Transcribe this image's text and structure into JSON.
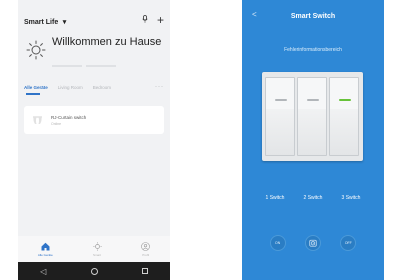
{
  "left_app": {
    "title": "Smart Life",
    "title_caret": "▾",
    "welcome": "Willkommen zu Hause",
    "tabs": [
      {
        "label": "Alle Geräte",
        "active": true
      },
      {
        "label": "Living Room",
        "active": false
      },
      {
        "label": "Bedroom",
        "active": false
      }
    ],
    "more": "···",
    "device": {
      "name": "RJ-Curtain switch",
      "status": "Online"
    },
    "nav": [
      {
        "label": "Alle Geräte",
        "icon": "home-icon",
        "active": true
      },
      {
        "label": "Smart",
        "icon": "sun-outline-icon",
        "active": false
      },
      {
        "label": "Profil",
        "icon": "profile-icon",
        "active": false
      }
    ],
    "android": {
      "back": "◁"
    }
  },
  "right_app": {
    "title": "Smart Switch",
    "back": "<",
    "fault_area": "Fehlerinformationsbereich",
    "switches": [
      {
        "label": "1 Switch",
        "on": false
      },
      {
        "label": "2 Switch",
        "on": false
      },
      {
        "label": "3 Switch",
        "on": true
      }
    ],
    "controls": {
      "on": "ON",
      "off": "OFF"
    }
  },
  "colors": {
    "accent": "#2f74c8",
    "right_bg": "#2e88d6",
    "switch_on": "#67c23a"
  }
}
